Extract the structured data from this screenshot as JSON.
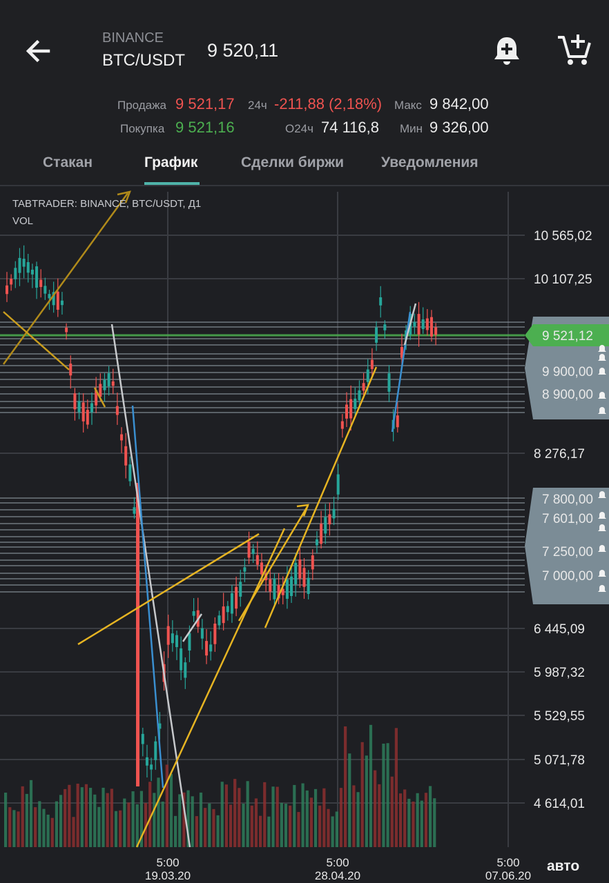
{
  "header": {
    "exchange": "BINANCE",
    "pair": "BTC/USDT",
    "last_price": "9 520,11",
    "stats": {
      "sell_label": "Продажа",
      "sell_value": "9 521,17",
      "buy_label": "Покупка",
      "buy_value": "9 521,16",
      "change_label": "24ч",
      "change_value": "-211,88 (2,18%)",
      "volume_label": "О24ч",
      "volume_value": "74 116,8",
      "max_label": "Макс",
      "max_value": "9 842,00",
      "min_label": "Мин",
      "min_value": "9 326,00"
    },
    "icons": {
      "back": "arrow-left-icon",
      "alert": "bell-plus-icon",
      "cart": "cart-plus-icon"
    }
  },
  "tabs": [
    {
      "label": "Стакан",
      "active": false
    },
    {
      "label": "График",
      "active": true
    },
    {
      "label": "Сделки биржи",
      "active": false
    },
    {
      "label": "Уведомления",
      "active": false
    }
  ],
  "chart": {
    "legend_line1": "TABTRADER: BINANCE, BTC/USDT, Д1",
    "legend_line2": "VOL",
    "auto_label": "авто",
    "price_axis": [
      "10 565,02",
      "10 107,25",
      "8 276,17",
      "6 445,09",
      "5 987,32",
      "5 529,55",
      "5 071,78",
      "4 614,01"
    ],
    "current_price_tag": "9 521,12",
    "alert_tags": [
      "9 900,00",
      "8 900,00",
      "7 800,00",
      "7 601,00",
      "7 250,00",
      "7 000,00"
    ],
    "time_axis": [
      {
        "time": "5:00",
        "date": "19.03.20"
      },
      {
        "time": "5:00",
        "date": "28.04.20"
      },
      {
        "time": "5:00",
        "date": "07.06.20"
      }
    ],
    "colors": {
      "up": "#26a69a",
      "down": "#ef5350",
      "trend": "#e6b422",
      "tag": "#7b8c96",
      "current": "#4caf50"
    }
  }
}
